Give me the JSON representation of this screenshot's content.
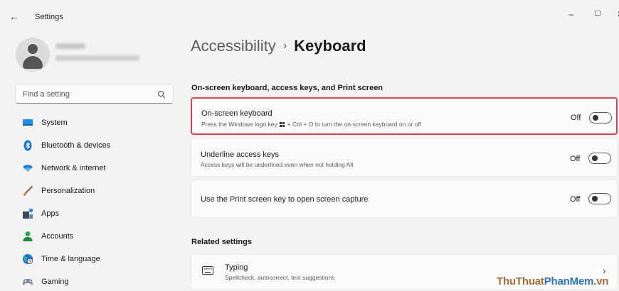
{
  "window": {
    "title": "Settings",
    "back_glyph": "←",
    "minimize_glyph": "–",
    "maximize_glyph": "☐",
    "close_glyph": "✕"
  },
  "sidebar": {
    "search": {
      "placeholder": "Find a setting",
      "value": ""
    },
    "items": [
      {
        "label": "System",
        "icon": "monitor-icon"
      },
      {
        "label": "Bluetooth & devices",
        "icon": "bluetooth-icon"
      },
      {
        "label": "Network & internet",
        "icon": "wifi-icon"
      },
      {
        "label": "Personalization",
        "icon": "brush-icon"
      },
      {
        "label": "Apps",
        "icon": "apps-icon"
      },
      {
        "label": "Accounts",
        "icon": "person-icon"
      },
      {
        "label": "Time & language",
        "icon": "globe-clock-icon"
      },
      {
        "label": "Gaming",
        "icon": "gamepad-icon"
      }
    ]
  },
  "breadcrumb": {
    "parent": "Accessibility",
    "separator": "›",
    "current": "Keyboard"
  },
  "section1": {
    "header": "On-screen keyboard, access keys, and Print screen",
    "cards": [
      {
        "title": "On-screen keyboard",
        "desc_before": "Press the Windows logo key",
        "desc_after": "+ Ctrl + O to turn the on-screen keyboard on or off",
        "state": "Off",
        "on": false
      },
      {
        "title": "Underline access keys",
        "desc": "Access keys will be underlined even when not holding Alt",
        "state": "Off",
        "on": false
      },
      {
        "title": "Use the Print screen key to open screen capture",
        "state": "Off",
        "on": false
      }
    ]
  },
  "section2": {
    "header": "Related settings",
    "typing": {
      "title": "Typing",
      "desc": "Spellcheck, autocorrect, text suggestions",
      "chevron": "›"
    }
  },
  "watermark": {
    "part1": "ThuThuat",
    "part2": "PhanMem",
    "part3": ".vn"
  },
  "colors": {
    "highlight_border": "#e0454a",
    "accent": "#0067c0",
    "background": "#f3f3f3",
    "card": "#fbfbfb"
  }
}
